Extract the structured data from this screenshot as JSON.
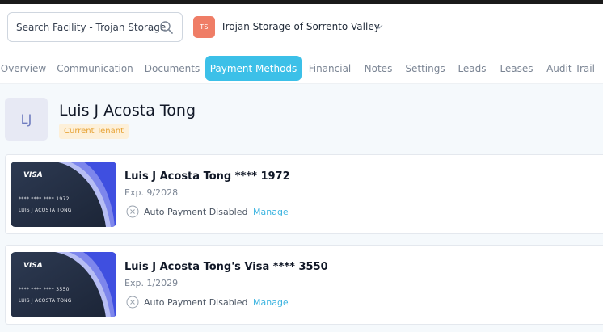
{
  "header": {
    "search_text": "Search Facility - Trojan Storage",
    "facility_initials": "TS",
    "facility_name": "Trojan Storage of Sorrento Valley"
  },
  "tabs": [
    {
      "label": "Overview"
    },
    {
      "label": "Communication"
    },
    {
      "label": "Documents"
    },
    {
      "label": "Payment Methods",
      "active": true
    },
    {
      "label": "Financial"
    },
    {
      "label": "Notes"
    },
    {
      "label": "Settings"
    },
    {
      "label": "Leads"
    },
    {
      "label": "Leases"
    },
    {
      "label": "Audit Trail"
    }
  ],
  "tenant": {
    "initials": "LJ",
    "name": "Luis J Acosta Tong",
    "status": "Current Tenant"
  },
  "payment_methods": [
    {
      "card_brand": "VISA",
      "card_mask": "**** **** **** 1972",
      "card_holder": "LUIS J ACOSTA TONG",
      "title": "Luis J Acosta Tong **** 1972",
      "expiry": "Exp. 9/2028",
      "auto_payment": "Auto Payment Disabled",
      "manage_label": "Manage"
    },
    {
      "card_brand": "VISA",
      "card_mask": "**** **** **** 3550",
      "card_holder": "LUIS J ACOSTA TONG",
      "title": "Luis J Acosta Tong's Visa **** 3550",
      "expiry": "Exp. 1/2029",
      "auto_payment": "Auto Payment Disabled",
      "manage_label": "Manage"
    }
  ],
  "icons": {
    "search": "search-icon",
    "dropdown": "chevron-down-icon",
    "auto_pay_status": "x-circle-icon"
  },
  "colors": {
    "accent": "#3cc0e8",
    "facility_badge": "#ef7d66",
    "status_badge_bg": "#fdf0d9",
    "status_badge_text": "#e6a234",
    "link": "#3cb4e0"
  }
}
